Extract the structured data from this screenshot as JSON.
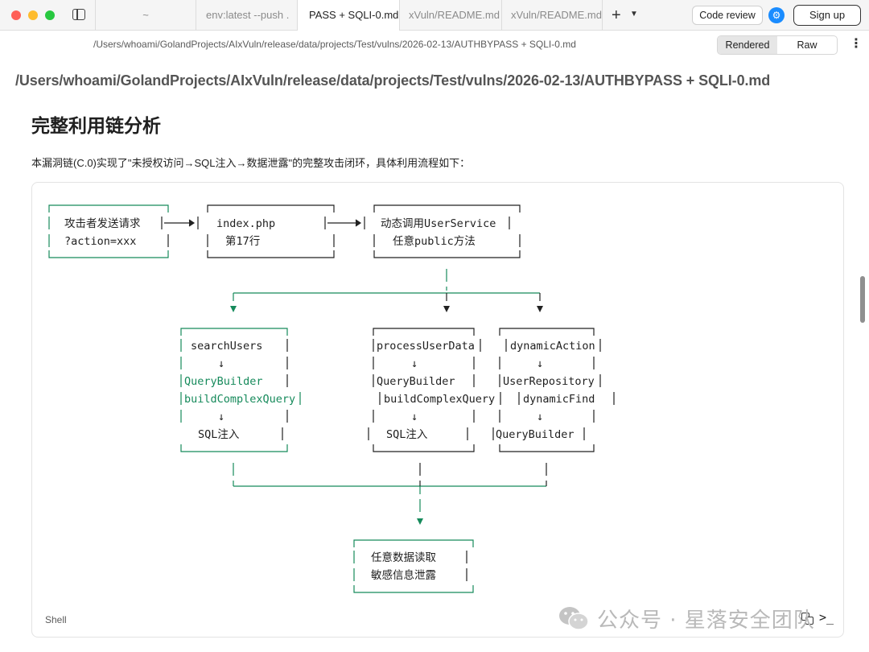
{
  "window": {
    "tabs": [
      {
        "label": "~",
        "active": false
      },
      {
        "label": "env:latest  --push .",
        "active": false
      },
      {
        "label": "PASS + SQLI-0.md",
        "active": true
      },
      {
        "label": "xVuln/README.md",
        "active": false
      },
      {
        "label": "xVuln/README.md",
        "active": false
      }
    ],
    "new_tab_symbol": "+",
    "menu_chevron": "⌄",
    "code_review_label": "Code review",
    "sign_up_label": "Sign up"
  },
  "pathbar": {
    "path": "/Users/whoami/GolandProjects/AIxVuln/release/data/projects/Test/vulns/2026-02-13/AUTHBYPASS + SQLI-0.md",
    "view_modes": [
      "Rendered",
      "Raw"
    ],
    "active_view": "Rendered"
  },
  "document": {
    "path_heading": "/Users/whoami/GolandProjects/AIxVuln/release/data/projects/Test/vulns/2026-02-13/AUTHBYPASS + SQLI-0.md",
    "section_title": "完整利用链分析",
    "intro": "本漏洞链(C.0)实现了\"未授权访问→SQL注入→数据泄露\"的完整攻击闭环，具体利用流程如下：",
    "code_language": "Shell",
    "diagram": {
      "attacker": [
        "攻击者发送请求",
        "?action=xxx"
      ],
      "index": [
        "index.php",
        "第17行"
      ],
      "dispatch": [
        "动态调用UserService",
        "任意public方法"
      ],
      "branch1": [
        "searchUsers",
        "↓",
        "QueryBuilder",
        "buildComplexQuery",
        "↓",
        "SQL注入"
      ],
      "branch2": [
        "processUserData",
        "↓",
        "QueryBuilder",
        "buildComplexQuery",
        "↓",
        "SQL注入"
      ],
      "branch3": [
        "dynamicAction",
        "↓",
        "UserRepository",
        "dynamicFind",
        "↓",
        "QueryBuilder"
      ],
      "result": [
        "任意数据读取",
        "敏感信息泄露"
      ]
    }
  },
  "watermark": {
    "text": "公众号 · 星落安全团队"
  },
  "colors": {
    "highlight_green": "#168a5b",
    "text_dark": "#1f1f1f",
    "accent_blue": "#1a8cff"
  }
}
